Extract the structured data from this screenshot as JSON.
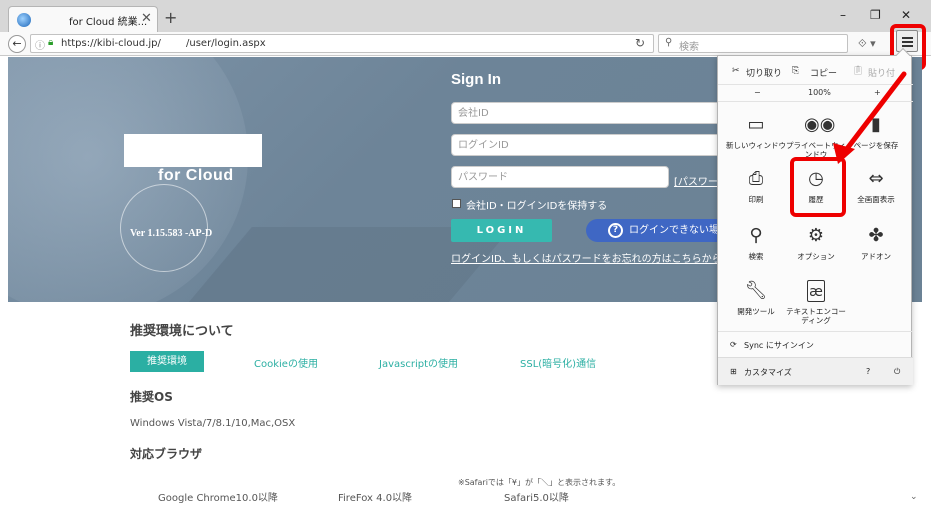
{
  "browser": {
    "tab_title": "for Cloud 統業...",
    "tab_close": "✕",
    "new_tab": "+",
    "window_minimize": "–",
    "window_restore": "❐",
    "window_close": "✕",
    "url_host": "https://kibi-cloud.jp/",
    "url_path": "/user/login.aspx",
    "search_placeholder": "検索"
  },
  "hero": {
    "logo_text": "for  Cloud",
    "version": "Ver 1.15.583 -AP-D",
    "signin_title": "Sign In",
    "company_id_placeholder": "会社ID",
    "login_id_placeholder": "ログインID",
    "password_placeholder": "パスワード",
    "password_link": "[パスワード",
    "remember_label": "会社ID・ログインIDを保持する",
    "login_button": "LOGIN",
    "cant_login_button": "ログインできない場",
    "forgot_link": "ログインID、もしくはパスワードをお忘れの方はこちらから"
  },
  "content": {
    "section_title": "推奨環境について",
    "tabs": [
      "推奨環境",
      "Cookieの使用",
      "Javascriptの使用",
      "SSL(暗号化)通信"
    ],
    "os_heading": "推奨OS",
    "os_value": "Windows Vista/7/8.1/10,Mac,OSX",
    "browser_heading": "対応ブラウザ",
    "safari_note": "※Safariでは「¥」が「＼」と表示されます。",
    "browsers": [
      "Google Chrome10.0以降",
      "FireFox 4.0以降",
      "Safari5.0以降"
    ]
  },
  "menu": {
    "cut": "切り取り",
    "copy": "コピー",
    "paste": "貼り付",
    "zoom_minus": "−",
    "zoom_level": "100%",
    "zoom_plus": "+",
    "items": [
      {
        "label": "新しいウィンドウ",
        "icon": "window-icon"
      },
      {
        "label": "プライベートウィンドウ",
        "icon": "mask-icon"
      },
      {
        "label": "ページを保存",
        "icon": "save-page-icon"
      },
      {
        "label": "印刷",
        "icon": "print-icon"
      },
      {
        "label": "履歴",
        "icon": "history-clock-icon"
      },
      {
        "label": "全画面表示",
        "icon": "fullscreen-icon"
      },
      {
        "label": "検索",
        "icon": "search-icon"
      },
      {
        "label": "オプション",
        "icon": "gear-icon"
      },
      {
        "label": "アドオン",
        "icon": "puzzle-icon"
      },
      {
        "label": "開発ツール",
        "icon": "wrench-icon"
      },
      {
        "label": "テキストエンコーディング",
        "icon": "encoding-icon"
      }
    ],
    "sync": "Sync にサインイン",
    "customize": "カスタマイズ"
  },
  "colors": {
    "highlight": "#ee0000",
    "accent_teal": "#2bafa3",
    "button_blue": "#3f67c4",
    "hero_bg": "#6d8498"
  }
}
